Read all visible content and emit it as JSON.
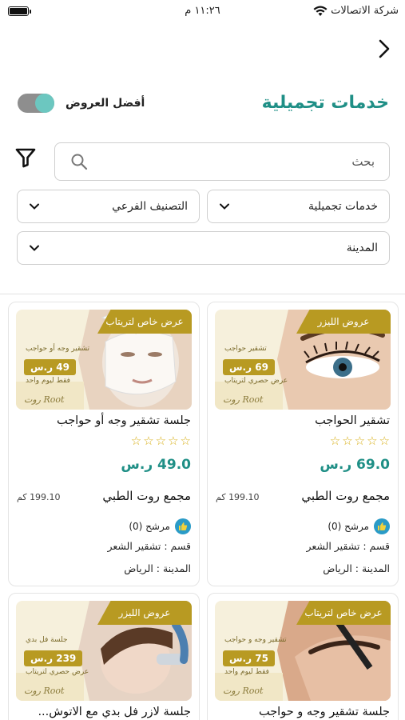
{
  "status": {
    "carrier": "شركة الاتصالات",
    "time": "١١:٢٦ م"
  },
  "header": {
    "title": "خدمات تجميلية",
    "best_offers_label": "أفضل العروض",
    "best_offers_on": true
  },
  "search": {
    "placeholder": "بحث"
  },
  "filters": {
    "category": "خدمات تجميلية",
    "subcategory": "التصنيف الفرعي",
    "city": "المدينة"
  },
  "colors": {
    "accent": "#1f8f86",
    "gold": "#b89a22",
    "star": "#d8b01a"
  },
  "cards": [
    {
      "name": "تشقير الحواجب",
      "rating": 0,
      "price": "69.0 ر.س",
      "center": "مجمع روت الطبي",
      "distance": "199.10 كم",
      "recommend": "مرشح (0)",
      "section": "قسم : تشقير الشعر",
      "city": "المدينة : الرياض",
      "banner": {
        "ribbon": "عروض الليزر",
        "line1": "تشقير حواجب",
        "amount": "69",
        "currency": "ر.س",
        "note": "عرض حصري لتريتاب",
        "logo": "Root روت"
      }
    },
    {
      "name": "جلسة تشقير وجه أو حواجب",
      "rating": 0,
      "price": "49.0 ر.س",
      "center": "مجمع روت الطبي",
      "distance": "199.10 كم",
      "recommend": "مرشح (0)",
      "section": "قسم : تشقير الشعر",
      "city": "المدينة : الرياض",
      "banner": {
        "ribbon": "عرض خاص لتريتاب",
        "line1": "تشقير وجه أو حواجب",
        "amount": "49",
        "currency": "ر.س",
        "note": "فقط ليوم واحد",
        "logo": "Root روت"
      }
    },
    {
      "name": "جلسة تشقير وجه و حواجب",
      "rating": 0,
      "banner": {
        "ribbon": "عرض خاص لتريتاب",
        "line1": "تشقير وجه و حواجب",
        "amount": "75",
        "currency": "ر.س",
        "note": "فقط ليوم واحد",
        "logo": "Root روت"
      }
    },
    {
      "name": "جلسة لازر فل بدي مع الاتوش...",
      "rating": 0,
      "banner": {
        "ribbon": "عروض الليزر",
        "line1": "جلسة فل بدي",
        "amount": "239",
        "currency": "ر.س",
        "note": "عرض حصري لتريتاب",
        "logo": "Root روت"
      }
    }
  ]
}
